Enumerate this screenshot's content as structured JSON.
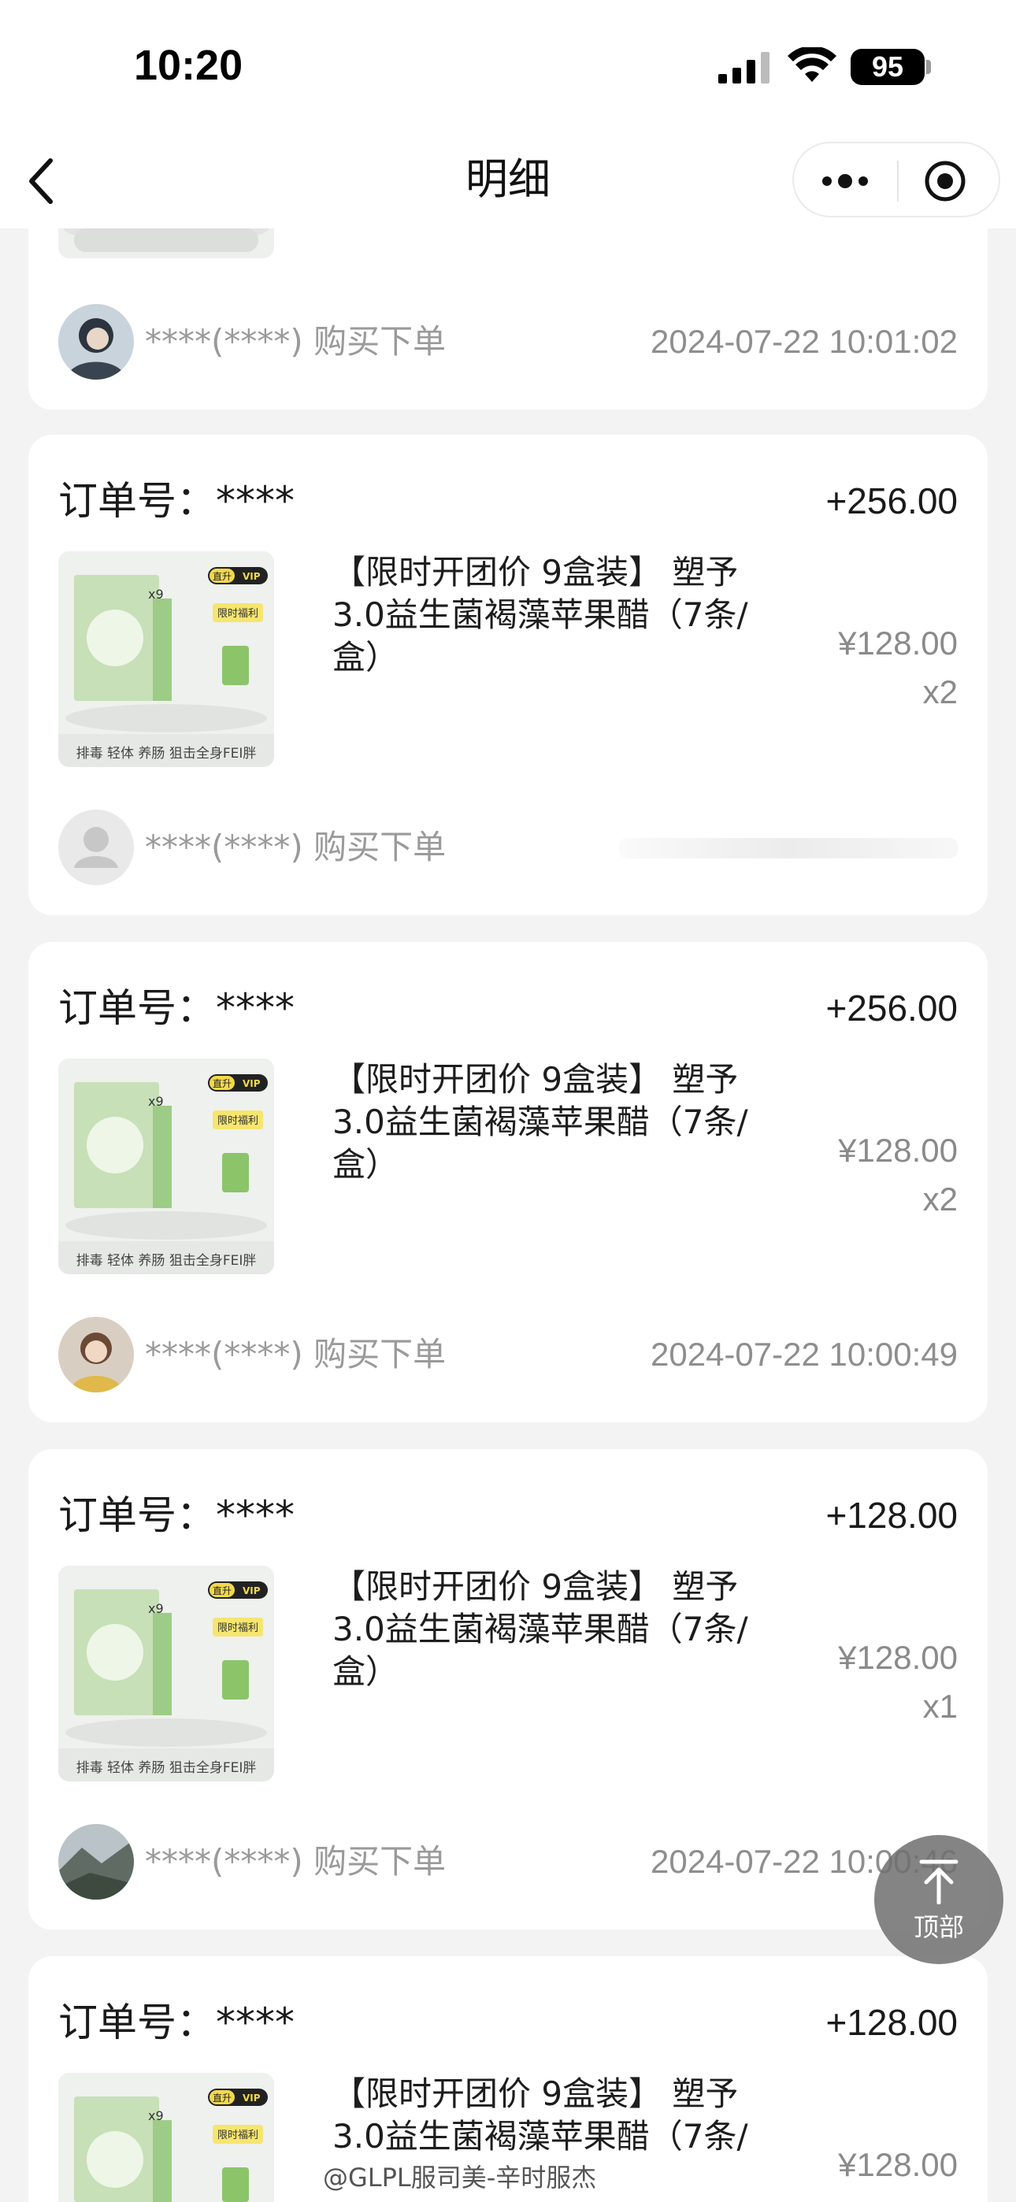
{
  "status_bar": {
    "time": "10:20",
    "battery": "95"
  },
  "nav": {
    "title": "明细"
  },
  "top_card": {
    "buyer": "****(****) 购买下单",
    "time": "2024-07-22 10:01:02"
  },
  "orders": [
    {
      "order_label": "订单号：****",
      "amount": "+256.00",
      "title_line1": "【限时开团价 9盒装】 塑予",
      "title_line2": "3.0益生菌褐藻苹果醋（7条/",
      "title_line3": "盒）",
      "price": "¥128.00",
      "qty": "x2",
      "buyer": "****(****) 购买下单",
      "time": ""
    },
    {
      "order_label": "订单号：****",
      "amount": "+256.00",
      "title_line1": "【限时开团价 9盒装】 塑予",
      "title_line2": "3.0益生菌褐藻苹果醋（7条/",
      "title_line3": "盒）",
      "price": "¥128.00",
      "qty": "x2",
      "buyer": "****(****) 购买下单",
      "time": "2024-07-22 10:00:49"
    },
    {
      "order_label": "订单号：****",
      "amount": "+128.00",
      "title_line1": "【限时开团价 9盒装】 塑予",
      "title_line2": "3.0益生菌褐藻苹果醋（7条/",
      "title_line3": "盒）",
      "price": "¥128.00",
      "qty": "x1",
      "buyer": "****(****) 购买下单",
      "time": "2024-07-22 10:00:46"
    },
    {
      "order_label": "订单号：****",
      "amount": "+128.00",
      "title_line1": "【限时开团价 9盒装】 塑予",
      "title_line2": "3.0益生菌褐藻苹果醋（7条/",
      "title_line3": "",
      "price": "¥128.00",
      "qty": "",
      "buyer": "",
      "time": ""
    }
  ],
  "thumb": {
    "caption": "排毒 轻体 养肠 狙击全身FEI胖",
    "badge": "直升 VIP",
    "tag": "限时福利",
    "multiplier": "x9"
  },
  "top_button": {
    "label": "顶部"
  },
  "watermark": "@GLPL服司美-辛时服杰"
}
